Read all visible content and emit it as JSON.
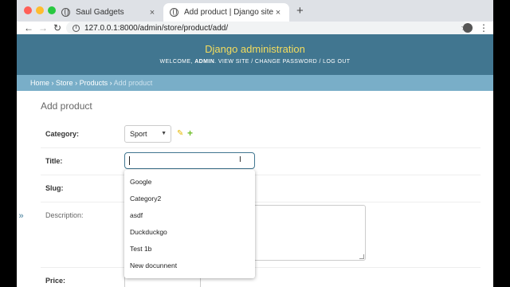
{
  "browser": {
    "tabs": [
      {
        "title": "Saul Gadgets",
        "active": false
      },
      {
        "title": "Add product | Django site admi",
        "active": true
      }
    ],
    "new_tab_label": "+",
    "close_glyph": "×",
    "url": "127.0.0.1:8000/admin/store/product/add/",
    "icons": [
      "back-icon",
      "forward-icon",
      "reload-icon",
      "info-icon",
      "star-icon",
      "profile-icon",
      "menu-icon"
    ]
  },
  "header": {
    "brand": "Django administration",
    "welcome": "WELCOME,",
    "username": "ADMIN",
    "view_site": "VIEW SITE",
    "change_password": "CHANGE PASSWORD",
    "logout": "LOG OUT",
    "colors": {
      "header_bg": "#417690",
      "brand": "#f5dd5d",
      "breadcrumb_bg": "#79aec8"
    }
  },
  "breadcrumbs": {
    "home": "Home",
    "app": "Store",
    "model": "Products",
    "current": "Add product",
    "separator": "›"
  },
  "page": {
    "title": "Add product"
  },
  "form": {
    "category": {
      "label": "Category:",
      "selected": "Sport"
    },
    "title": {
      "label": "Title:",
      "value": ""
    },
    "slug": {
      "label": "Slug:"
    },
    "description": {
      "label": "Description:"
    },
    "price": {
      "label": "Price:"
    }
  },
  "autocomplete": {
    "items": [
      "Google",
      "Category2",
      "asdf",
      "Duckduckgo",
      "Test 1b",
      "New docunnent"
    ]
  },
  "sidebar": {
    "toggle_glyph": "»"
  }
}
